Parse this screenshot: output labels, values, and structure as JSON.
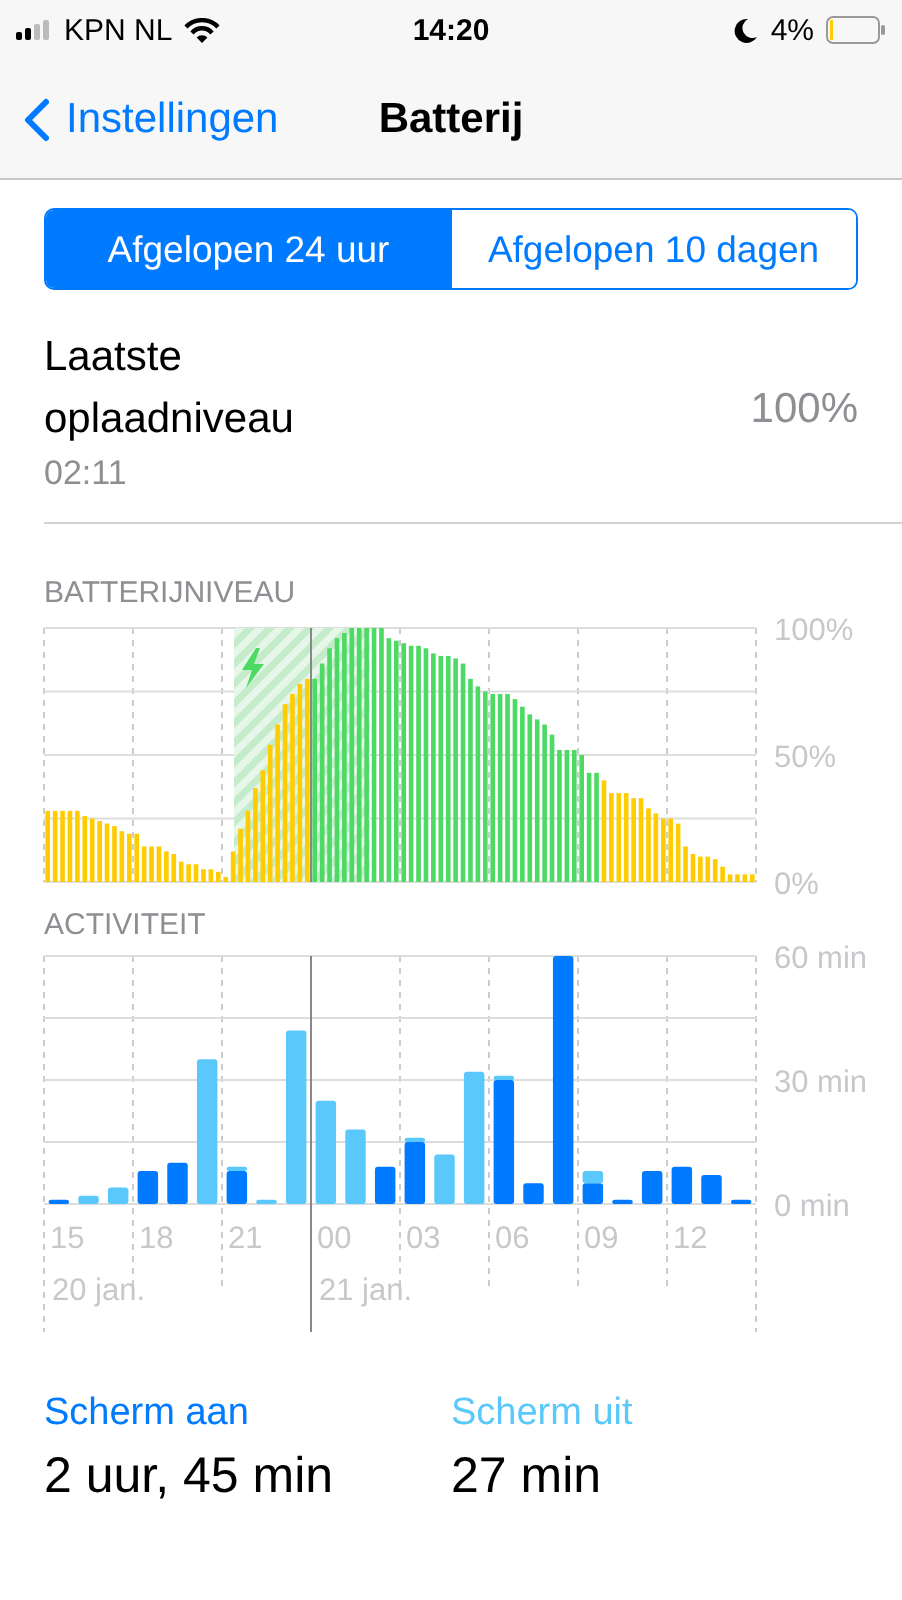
{
  "status_bar": {
    "carrier": "KPN NL",
    "time": "14:20",
    "battery": "4%"
  },
  "nav": {
    "back": "Instellingen",
    "title": "Batterij"
  },
  "tabs": [
    {
      "label": "Afgelopen 24 uur",
      "selected": true
    },
    {
      "label": "Afgelopen 10 dagen",
      "selected": false
    }
  ],
  "last_charge": {
    "label": "Laatste oplaadniveau",
    "time": "02:11",
    "value": "100%"
  },
  "battery_level": {
    "title": "BATTERIJNIVEAU",
    "chart_data": {
      "type": "bar",
      "ylim": [
        0,
        100
      ],
      "yticks": [
        {
          "value": 0,
          "label": "0%"
        },
        {
          "value": 50,
          "label": "50%"
        },
        {
          "value": 100,
          "label": "100%"
        }
      ],
      "series": [
        {
          "color": "#ffcc00",
          "values": [
            28,
            28,
            28,
            28,
            28,
            26,
            25,
            24,
            23,
            22,
            20,
            19,
            19,
            14,
            14,
            14,
            12,
            11,
            8,
            7,
            7,
            5,
            5,
            4,
            2,
            12,
            21,
            28,
            37,
            44,
            54,
            62,
            70,
            74,
            78,
            80,
            null,
            null,
            null,
            null,
            null,
            null,
            null,
            null,
            null,
            null,
            null,
            null,
            null,
            null,
            null,
            null,
            null,
            null,
            null,
            null,
            null,
            null,
            null,
            null,
            null,
            null,
            null,
            null,
            null,
            null,
            null,
            null,
            null,
            null,
            null,
            null,
            null,
            null,
            null,
            40,
            35,
            35,
            35,
            33,
            33,
            29,
            27,
            25,
            25,
            23,
            14,
            11,
            10,
            10,
            9,
            6,
            3,
            3,
            3,
            3
          ]
        },
        {
          "color": "#4cd964",
          "values": [
            null,
            null,
            null,
            null,
            null,
            null,
            null,
            null,
            null,
            null,
            null,
            null,
            null,
            null,
            null,
            null,
            null,
            null,
            null,
            null,
            null,
            null,
            null,
            null,
            null,
            null,
            null,
            null,
            null,
            null,
            null,
            null,
            null,
            null,
            null,
            null,
            80,
            86,
            92,
            96,
            98,
            100,
            100,
            100,
            100,
            100,
            96,
            95,
            94,
            93,
            93,
            92,
            90,
            89,
            89,
            88,
            86,
            80,
            77,
            75,
            74,
            74,
            74,
            72,
            69,
            66,
            64,
            62,
            58,
            52,
            52,
            52,
            50,
            43,
            43,
            null,
            null,
            null,
            null,
            null,
            null,
            null,
            null,
            null,
            null,
            null,
            null,
            null,
            null,
            null,
            null,
            null,
            null,
            null,
            null,
            null
          ]
        }
      ]
    }
  },
  "activity": {
    "title": "ACTIVITEIT",
    "hour_labels": [
      "15",
      "18",
      "21",
      "00",
      "03",
      "06",
      "09",
      "12"
    ],
    "date_labels": [
      "20 jan.",
      "21 jan."
    ],
    "chart_data": {
      "type": "bar",
      "stacked": true,
      "ylim": [
        0,
        60
      ],
      "yticks": [
        {
          "value": 0,
          "label": "0 min"
        },
        {
          "value": 30,
          "label": "30 min"
        },
        {
          "value": 60,
          "label": "60 min"
        }
      ],
      "series": [
        {
          "name": "Scherm aan",
          "color": "#007aff",
          "values": [
            1,
            0,
            0,
            8,
            10,
            0,
            8,
            0,
            0,
            0,
            0,
            9,
            15,
            0,
            0,
            30,
            5,
            60,
            5,
            1,
            8,
            9,
            7,
            1
          ]
        },
        {
          "name": "Scherm uit",
          "color": "#5ac8fa",
          "values": [
            0,
            2,
            4,
            0,
            0,
            35,
            1,
            1,
            42,
            25,
            18,
            0,
            1,
            12,
            32,
            1,
            0,
            0,
            3,
            0,
            0,
            0,
            0,
            0
          ]
        }
      ]
    }
  },
  "summary": [
    {
      "value": "2 uur, 45 min"
    },
    {
      "value": "27 min"
    }
  ]
}
